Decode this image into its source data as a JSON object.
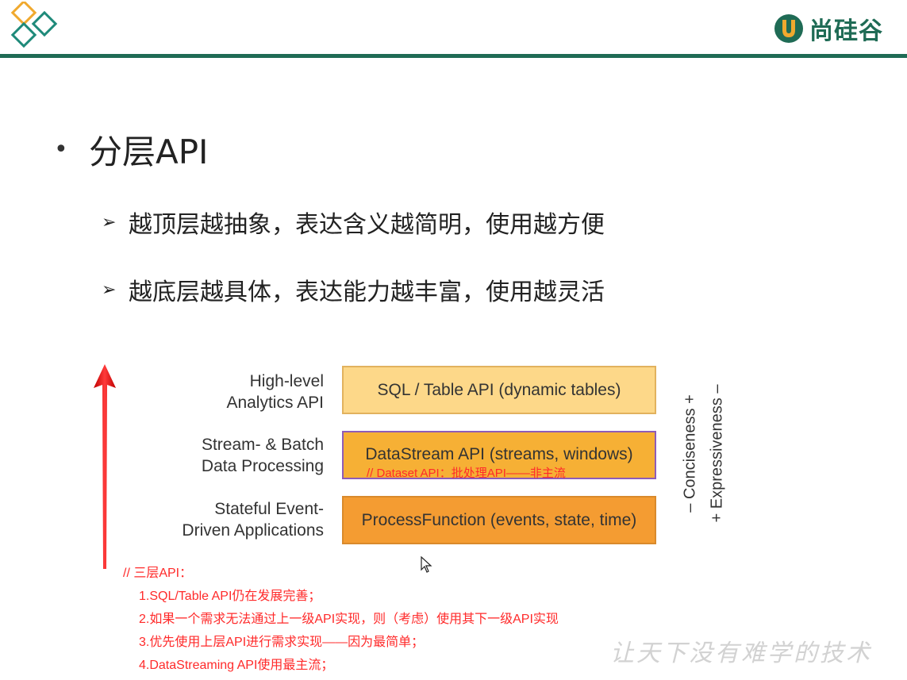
{
  "brand": {
    "name": "尚硅谷",
    "color": "#1f6b55"
  },
  "slide": {
    "title": "分层API",
    "bullets": [
      "越顶层越抽象，表达含义越简明，使用越方便",
      "越底层越具体，表达能力越丰富，使用越灵活"
    ]
  },
  "pyramid": {
    "rows": [
      {
        "label_line1": "High-level",
        "label_line2": "Analytics API",
        "box": "SQL / Table API (dynamic tables)",
        "color": "#fdd889"
      },
      {
        "label_line1": "Stream- & Batch",
        "label_line2": "Data Processing",
        "box": "DataStream API (streams, windows)",
        "color": "#f6b035"
      },
      {
        "label_line1": "Stateful Event-",
        "label_line2": "Driven Applications",
        "box": "ProcessFunction (events, state, time)",
        "color": "#f49c32"
      }
    ],
    "axis_conciseness": "– Conciseness +",
    "axis_expressiveness": "+ Expressiveness –",
    "dataset_note": "// Dataset API：批处理API——非主流"
  },
  "notes": {
    "heading": "// 三层API：",
    "items": [
      "1.SQL/Table API仍在发展完善；",
      "2.如果一个需求无法通过上一级API实现，则（考虑）使用其下一级API实现",
      "3.优先使用上层API进行需求实现——因为最简单；",
      "4.DataStreaming API使用最主流；"
    ],
    "color": "#ff2a2a"
  },
  "watermark": "让天下没有难学的技术",
  "icons": {
    "logo": "diamonds-logo-icon",
    "brand": "brand-u-icon",
    "arrow": "red-up-arrow-icon",
    "cursor": "mouse-cursor-icon"
  }
}
